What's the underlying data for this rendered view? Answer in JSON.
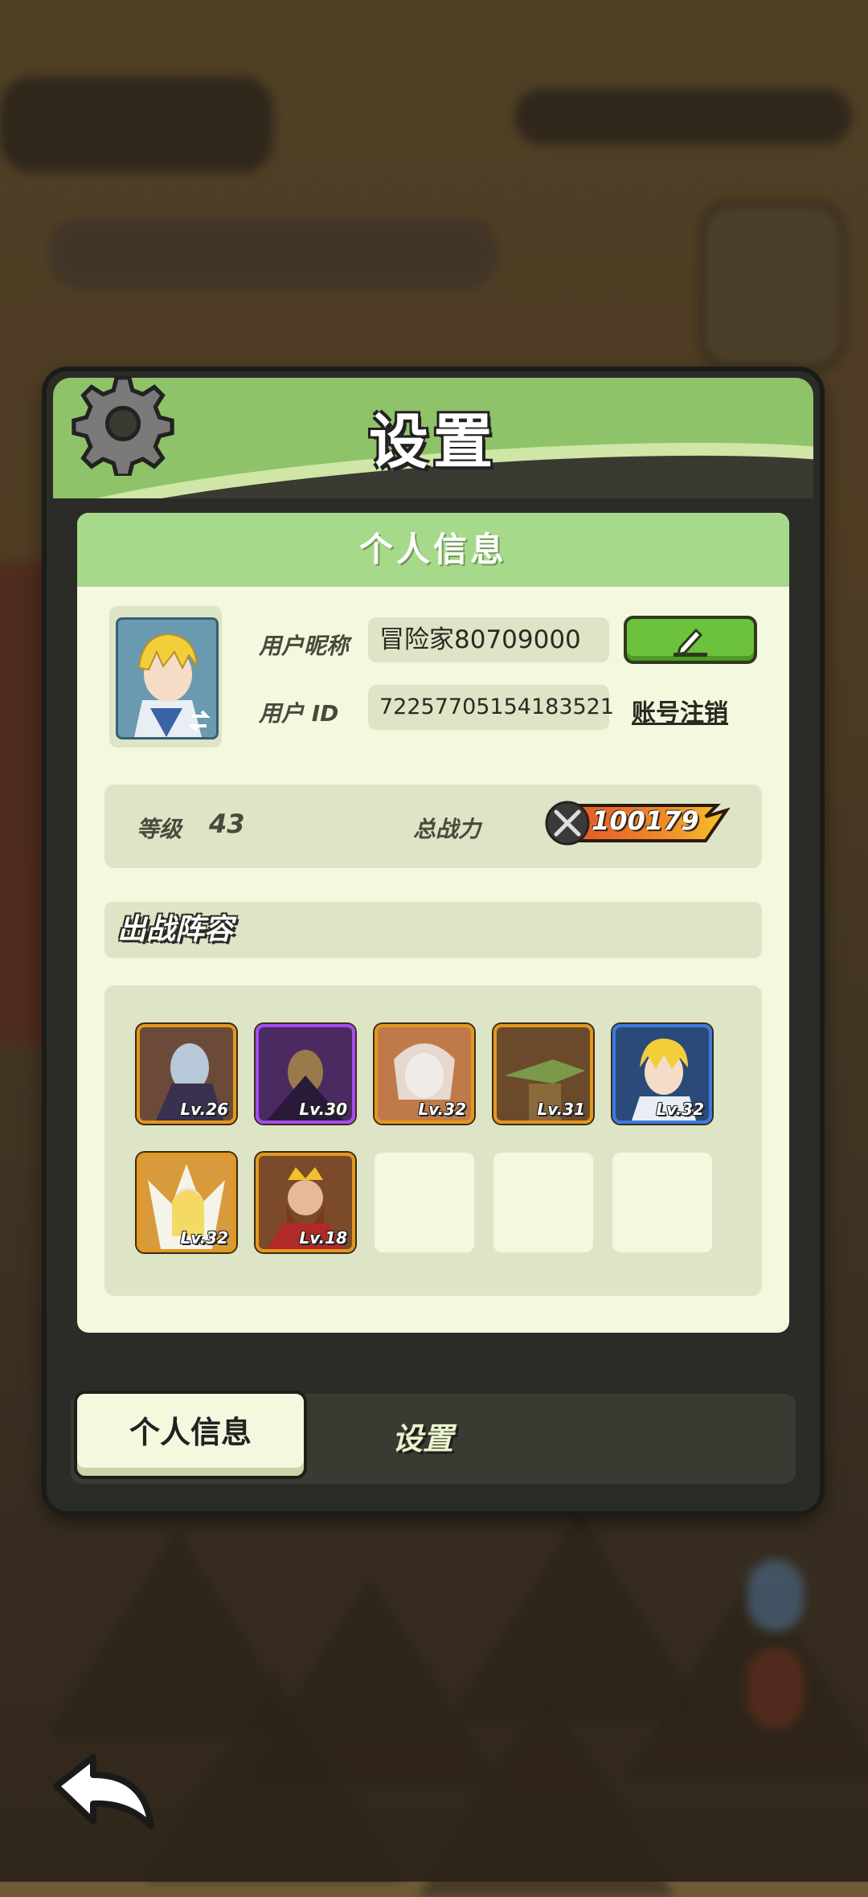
{
  "title": "设置",
  "section_title": "个人信息",
  "profile": {
    "nickname_label": "用户昵称",
    "nickname": "冒险家80709000",
    "id_label": "用户 ID",
    "user_id": "72257705154183521",
    "logout_label": "账号注销",
    "edit_icon": "pencil-icon"
  },
  "stats": {
    "level_label": "等级",
    "level": "43",
    "power_label": "总战力",
    "power": "100179"
  },
  "lineup": {
    "title": "出战阵容",
    "heroes": [
      {
        "level": "Lv.26",
        "frame": "orange"
      },
      {
        "level": "Lv.30",
        "frame": "purple"
      },
      {
        "level": "Lv.32",
        "frame": "orange"
      },
      {
        "level": "Lv.31",
        "frame": "orange"
      },
      {
        "level": "Lv.32",
        "frame": "blue"
      },
      {
        "level": "Lv.32",
        "frame": "orange"
      },
      {
        "level": "Lv.18",
        "frame": "orange"
      }
    ],
    "empty_slots": 3
  },
  "tabs": [
    {
      "label": "个人信息",
      "active": true
    },
    {
      "label": "设置",
      "active": false
    }
  ],
  "icons": {
    "header": "gear-icon",
    "back": "back-arrow-icon",
    "power": "crossed-swords-icon"
  }
}
